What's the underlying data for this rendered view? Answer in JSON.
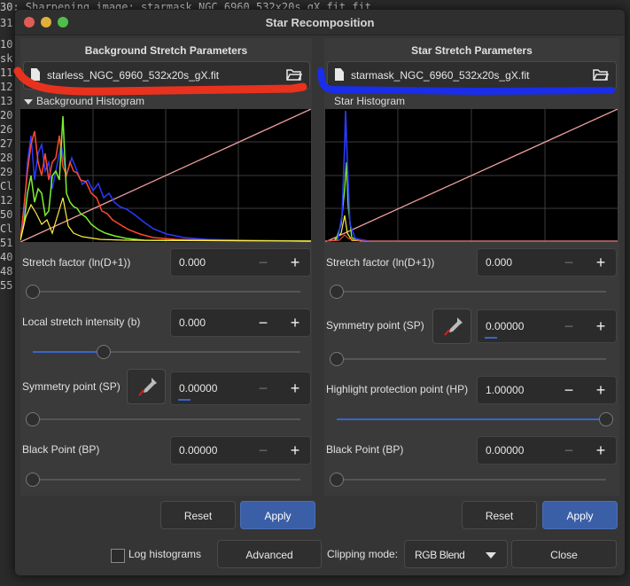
{
  "terminal_lines": [
    "30: Sharpening image: starmask_NGC_6960_532x20s_gX.fit.fit",
    "31",
    "10",
    "sk",
    "11",
    "12",
    "13",
    "20",
    "26",
    "27",
    "28",
    "29",
    "Cl",
    "12",
    "50",
    "Cl",
    "51",
    "40",
    "48",
    "55"
  ],
  "dialog": {
    "title": "Star Recomposition",
    "left": {
      "section_title": "Background Stretch Parameters",
      "file": "starless_NGC_6960_532x20s_gX.fit",
      "histogram_label": "Background Histogram",
      "stretch_factor": {
        "label": "Stretch factor (ln(D+1))",
        "value": "0.000",
        "level": 0.0
      },
      "local_intensity": {
        "label": "Local stretch intensity (b)",
        "value": "0.000",
        "level": 0.25
      },
      "symmetry": {
        "label": "Symmetry point (SP)",
        "value": "0.00000",
        "level": 0.0
      },
      "black_point": {
        "label": "Black Point (BP)",
        "value": "0.00000",
        "level": 0.0
      },
      "reset": "Reset",
      "apply": "Apply"
    },
    "right": {
      "section_title": "Star Stretch Parameters",
      "file": "starmask_NGC_6960_532x20s_gX.fit",
      "histogram_label": "Star Histogram",
      "stretch_factor": {
        "label": "Stretch factor (ln(D+1))",
        "value": "0.000",
        "level": 0.0
      },
      "symmetry": {
        "label": "Symmetry point (SP)",
        "value": "0.00000",
        "level": 0.0
      },
      "highlight": {
        "label": "Highlight protection point (HP)",
        "value": "1.00000",
        "level": 1.0
      },
      "black_point": {
        "label": "Black Point (BP)",
        "value": "0.00000",
        "level": 0.0
      },
      "reset": "Reset",
      "apply": "Apply"
    },
    "footer": {
      "log_histograms": "Log histograms",
      "advanced": "Advanced",
      "clipping_label": "Clipping mode:",
      "clipping_value": "RGB Blend",
      "close": "Close"
    }
  },
  "colors": {
    "accent": "#3b5fa6",
    "close_btn": "#e25c57",
    "min_btn": "#e0b03a",
    "max_btn": "#4fbf4a",
    "annotation_red": "#e8321e",
    "annotation_blue": "#1a2de8",
    "hist_red": "#ff4a2a",
    "hist_green": "#7df030",
    "hist_blue": "#2a3aff",
    "hist_yellow": "#ffee40",
    "curve": "#f0a0a0"
  }
}
